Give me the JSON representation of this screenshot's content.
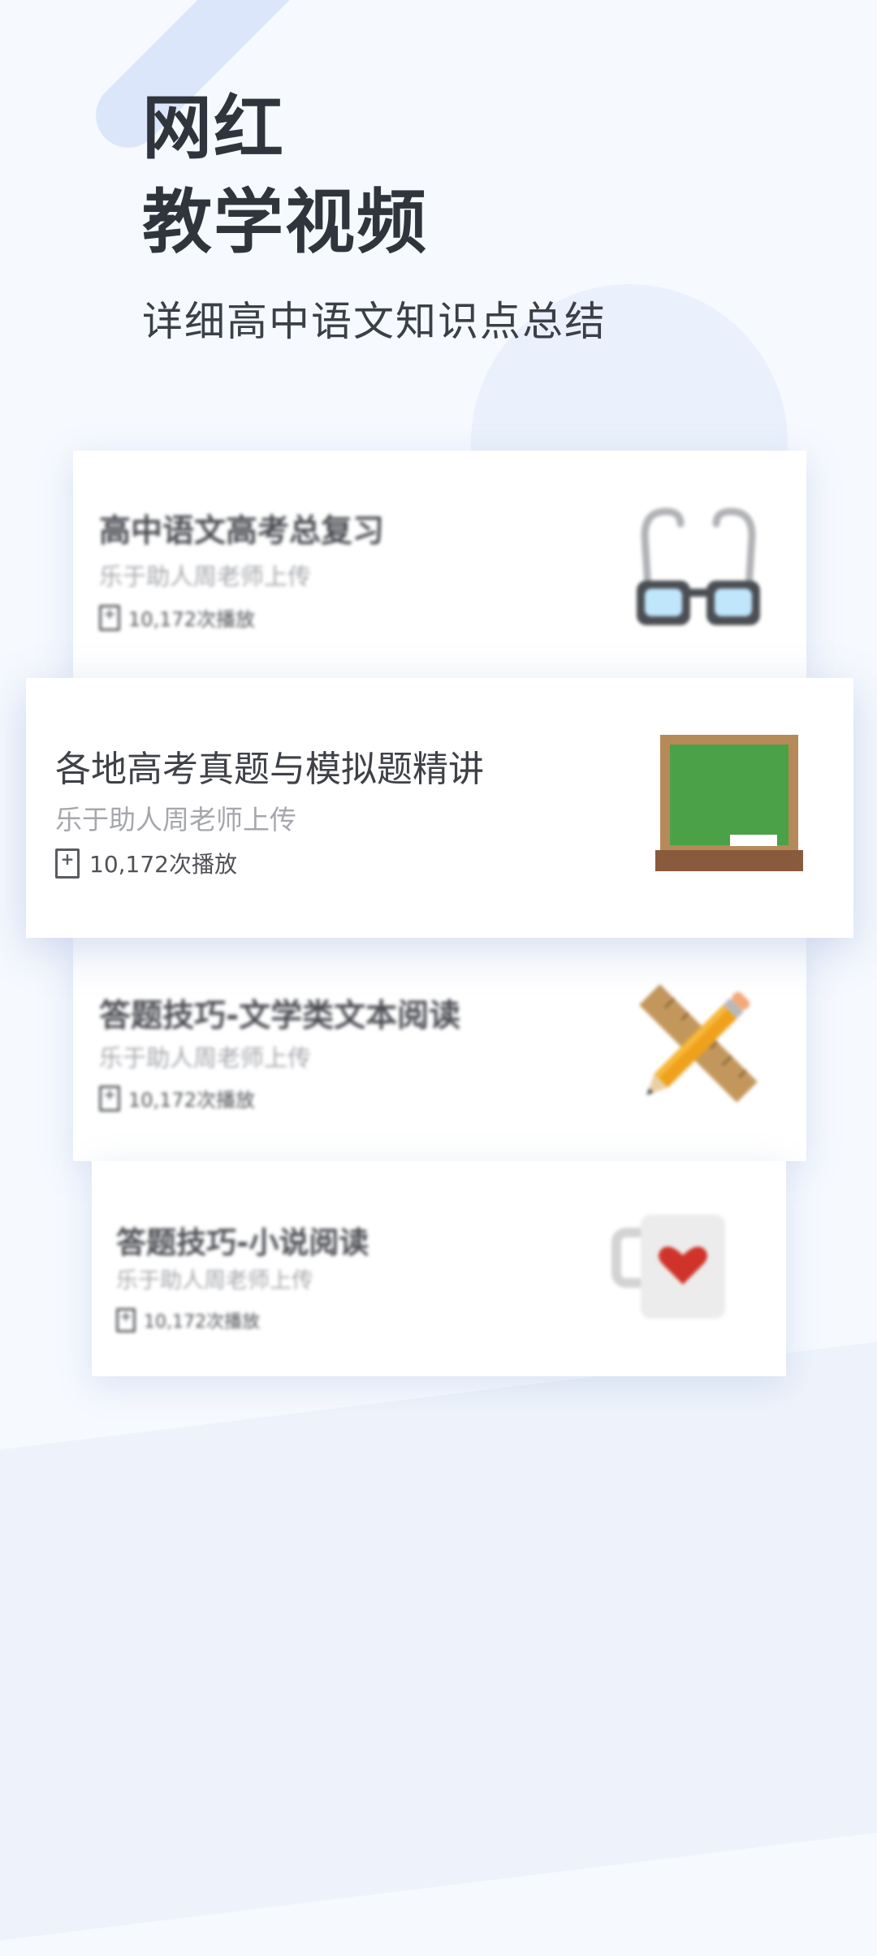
{
  "hero": {
    "title_line1": "网红",
    "title_line2": "教学视频",
    "subtitle": "详细高中语文知识点总结"
  },
  "cards": [
    {
      "title": "高中语文高考总复习",
      "uploader": "乐于助人周老师上传",
      "plays": "10,172次播放",
      "icon": "glasses-icon"
    },
    {
      "title": "各地高考真题与模拟题精讲",
      "uploader": "乐于助人周老师上传",
      "plays": "10,172次播放",
      "icon": "chalkboard-icon"
    },
    {
      "title": "答题技巧-文学类文本阅读",
      "uploader": "乐于助人周老师上传",
      "plays": "10,172次播放",
      "icon": "pencil-ruler-icon"
    },
    {
      "title": "答题技巧-小说阅读",
      "uploader": "乐于助人周老师上传",
      "plays": "10,172次播放",
      "icon": "heart-mug-icon"
    }
  ],
  "colors": {
    "background": "#f6f9fe",
    "chalkboard_green": "#4aa147",
    "frame_brown": "#b58a58",
    "pencil_orange": "#f0a11b",
    "heart_red": "#d0332a"
  }
}
